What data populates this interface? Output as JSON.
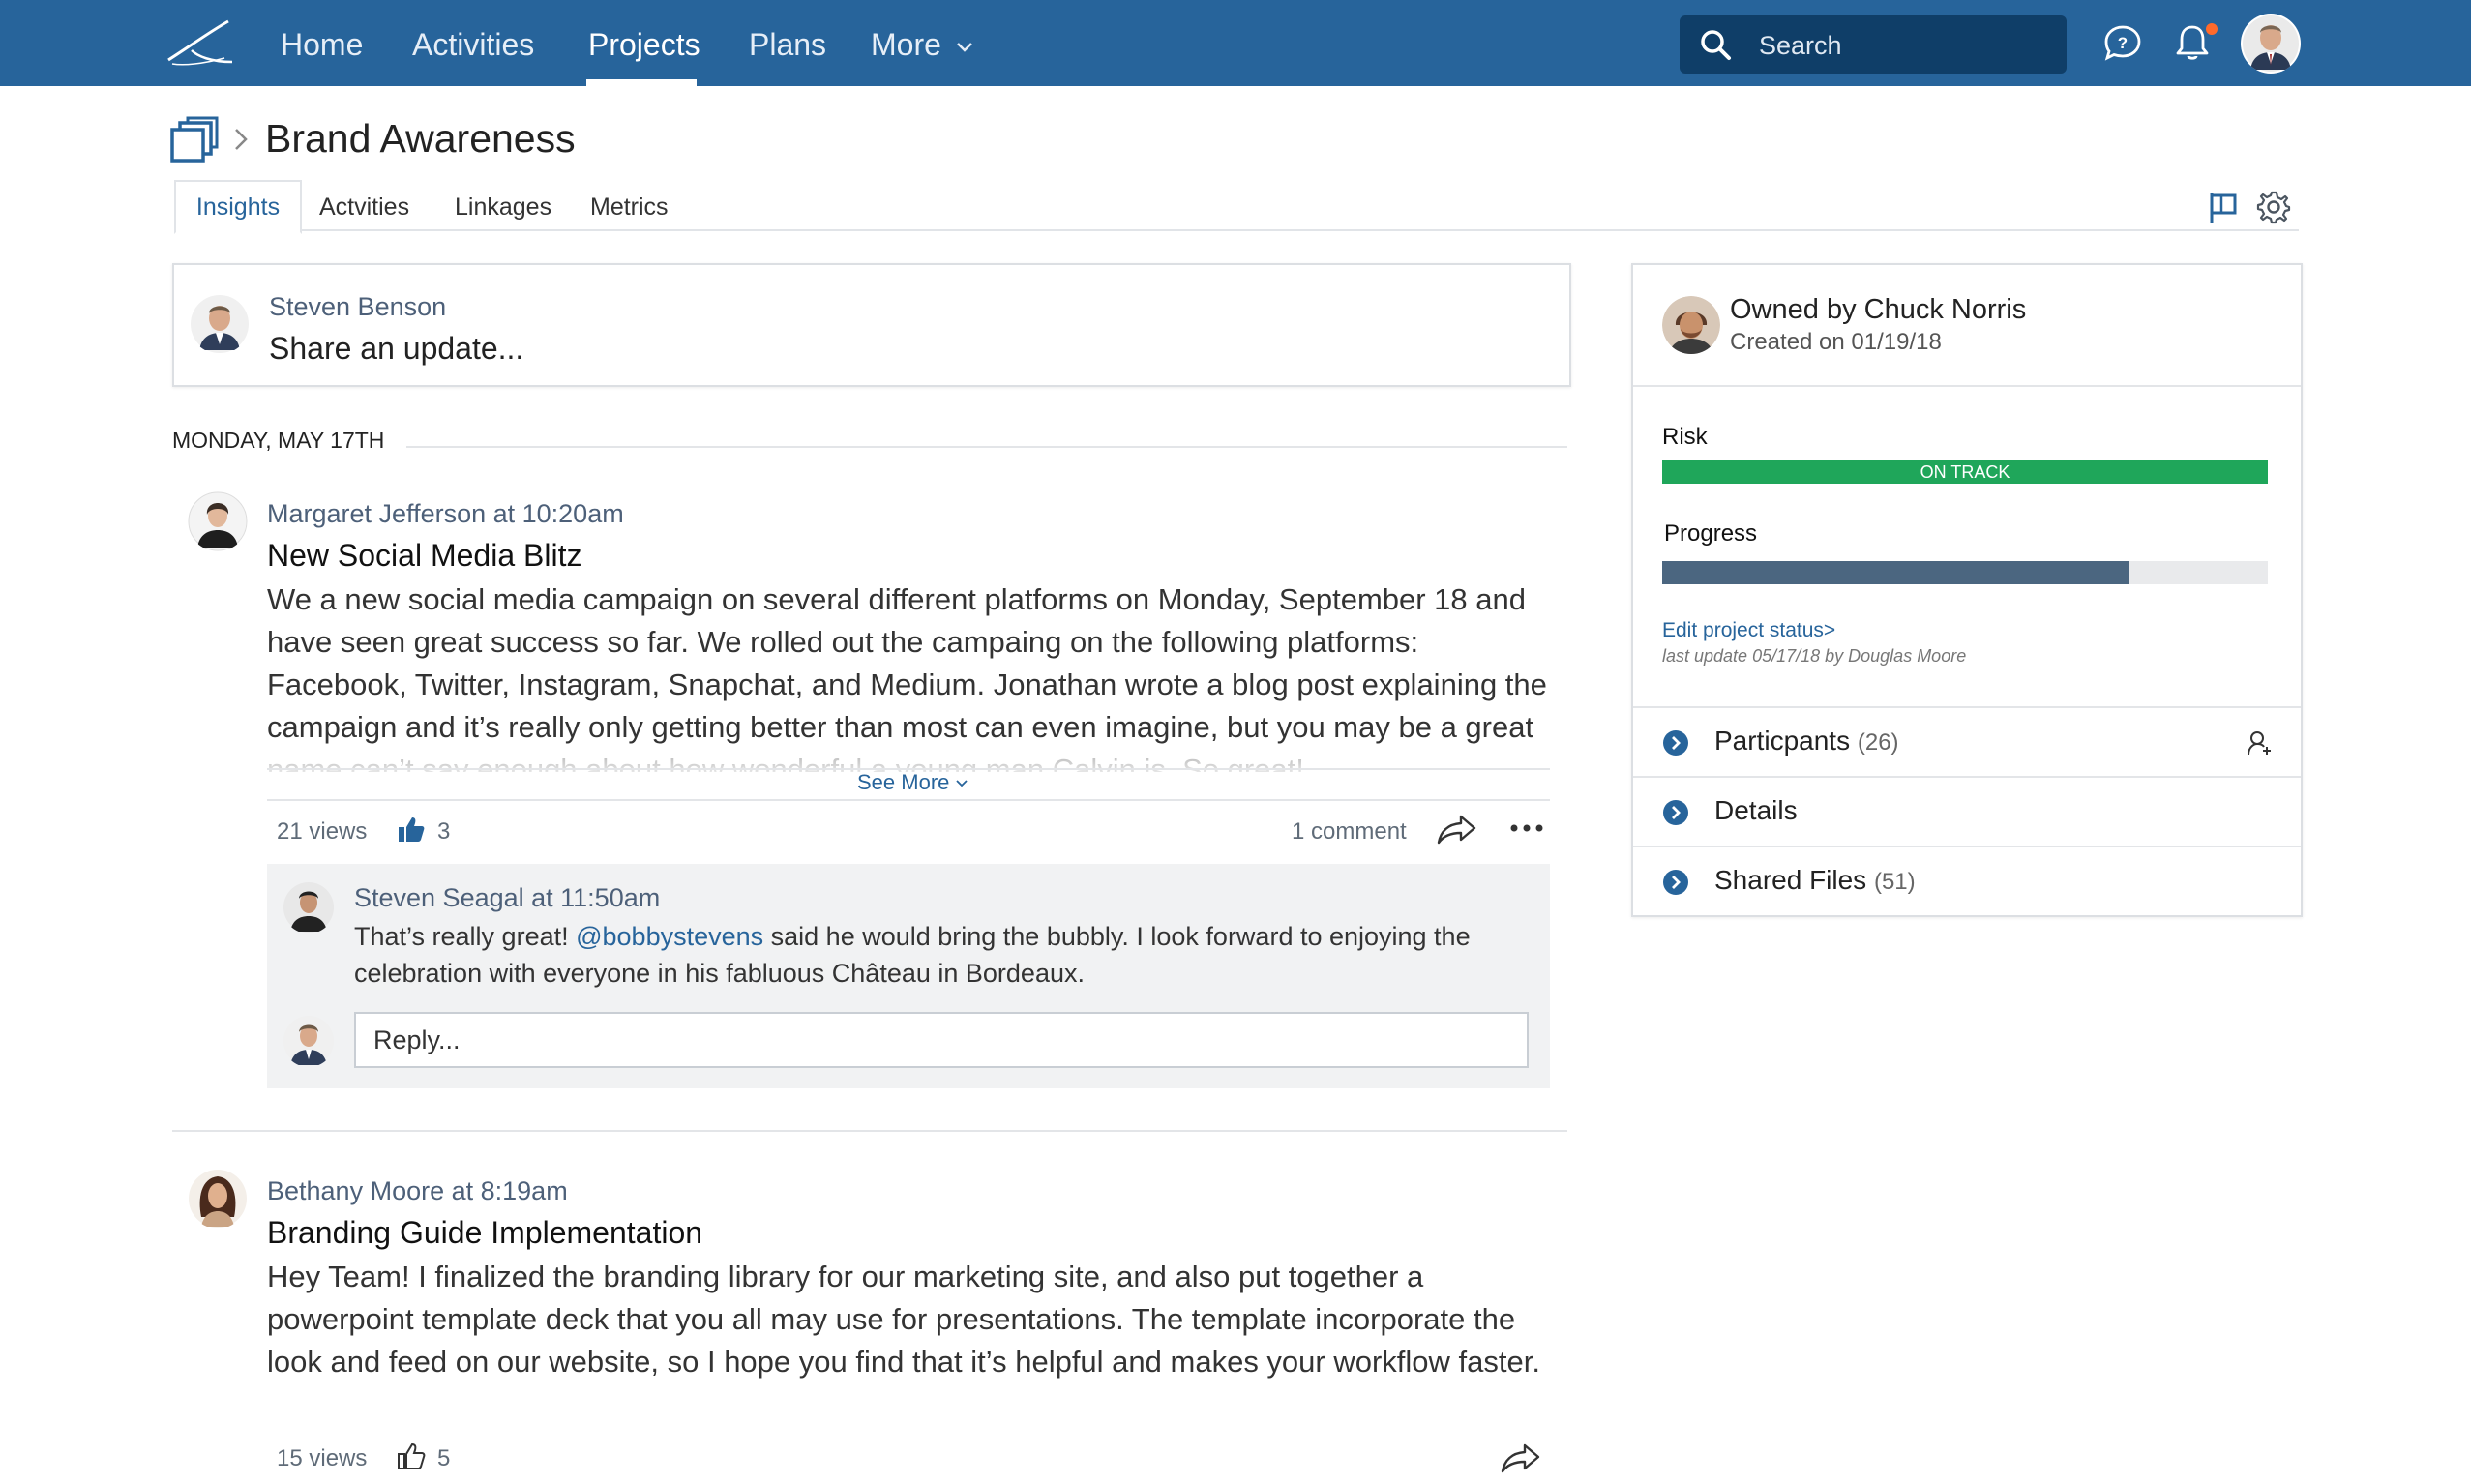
{
  "nav": {
    "items": [
      "Home",
      "Activities",
      "Projects",
      "Plans",
      "More"
    ],
    "active": "Projects",
    "search_placeholder": "Search",
    "brand_color": "#27649b",
    "icons": [
      "logo-icon",
      "search-icon",
      "chat-icon",
      "bell-icon",
      "chevron-down-icon"
    ]
  },
  "page": {
    "title": "Brand Awareness",
    "tabs": [
      "Insights",
      "Actvities",
      "Linkages",
      "Metrics"
    ],
    "active_tab": "Insights"
  },
  "share": {
    "user": "Steven Benson",
    "prompt": "Share an update..."
  },
  "feed": {
    "date_label": "MONDAY, MAY 17TH",
    "posts": [
      {
        "author": "Margaret Jefferson at 10:20am",
        "title": "New Social Media Blitz",
        "body": "We a new social media campaign on several different platforms on Monday, September 18 and have seen great success so far. We rolled out the campaing on the following platforms: Facebook, Twitter, Instagram, Snapchat, and Medium. Jonathan wrote a blog post explaining the campaign and it’s really only getting better than most can even imagine, but you may be a great name can’t say enough about how wonderful a young man Calvin is. So great!",
        "see_more": "See More",
        "views": "21 views",
        "likes": "3",
        "comments": "1 comment",
        "comment": {
          "author": "Steven Seagal at 11:50am",
          "text_before": "That’s really great! ",
          "mention": "@bobbystevens",
          "text_after": " said he would bring the bubbly. I look forward to enjoying the celebration with everyone in his fabluous Château in Bordeaux."
        },
        "reply_placeholder": "Reply..."
      },
      {
        "author": "Bethany Moore at 8:19am",
        "title": "Branding Guide Implementation",
        "body": "Hey Team! I finalized the branding library for our marketing site, and also put together a powerpoint template deck that you all may use for presentations. The template incorporate the look and feed on our website, so I hope you find that it’s helpful and makes your workflow faster.",
        "views": "15 views",
        "likes": "5"
      }
    ]
  },
  "side": {
    "owner": "Owned by Chuck Norris",
    "created": "Created on 01/19/18",
    "risk_label": "Risk",
    "risk_status": "ON TRACK",
    "risk_color": "#1fa65a",
    "progress_label": "Progress",
    "progress_fraction": 0.77,
    "edit_link": "Edit project status>",
    "last_update": "last update 05/17/18 by Douglas Moore",
    "sections": [
      {
        "label": "Particpants",
        "count": "(26)"
      },
      {
        "label": "Details",
        "count": ""
      },
      {
        "label": "Shared Files",
        "count": "(51)"
      }
    ]
  }
}
